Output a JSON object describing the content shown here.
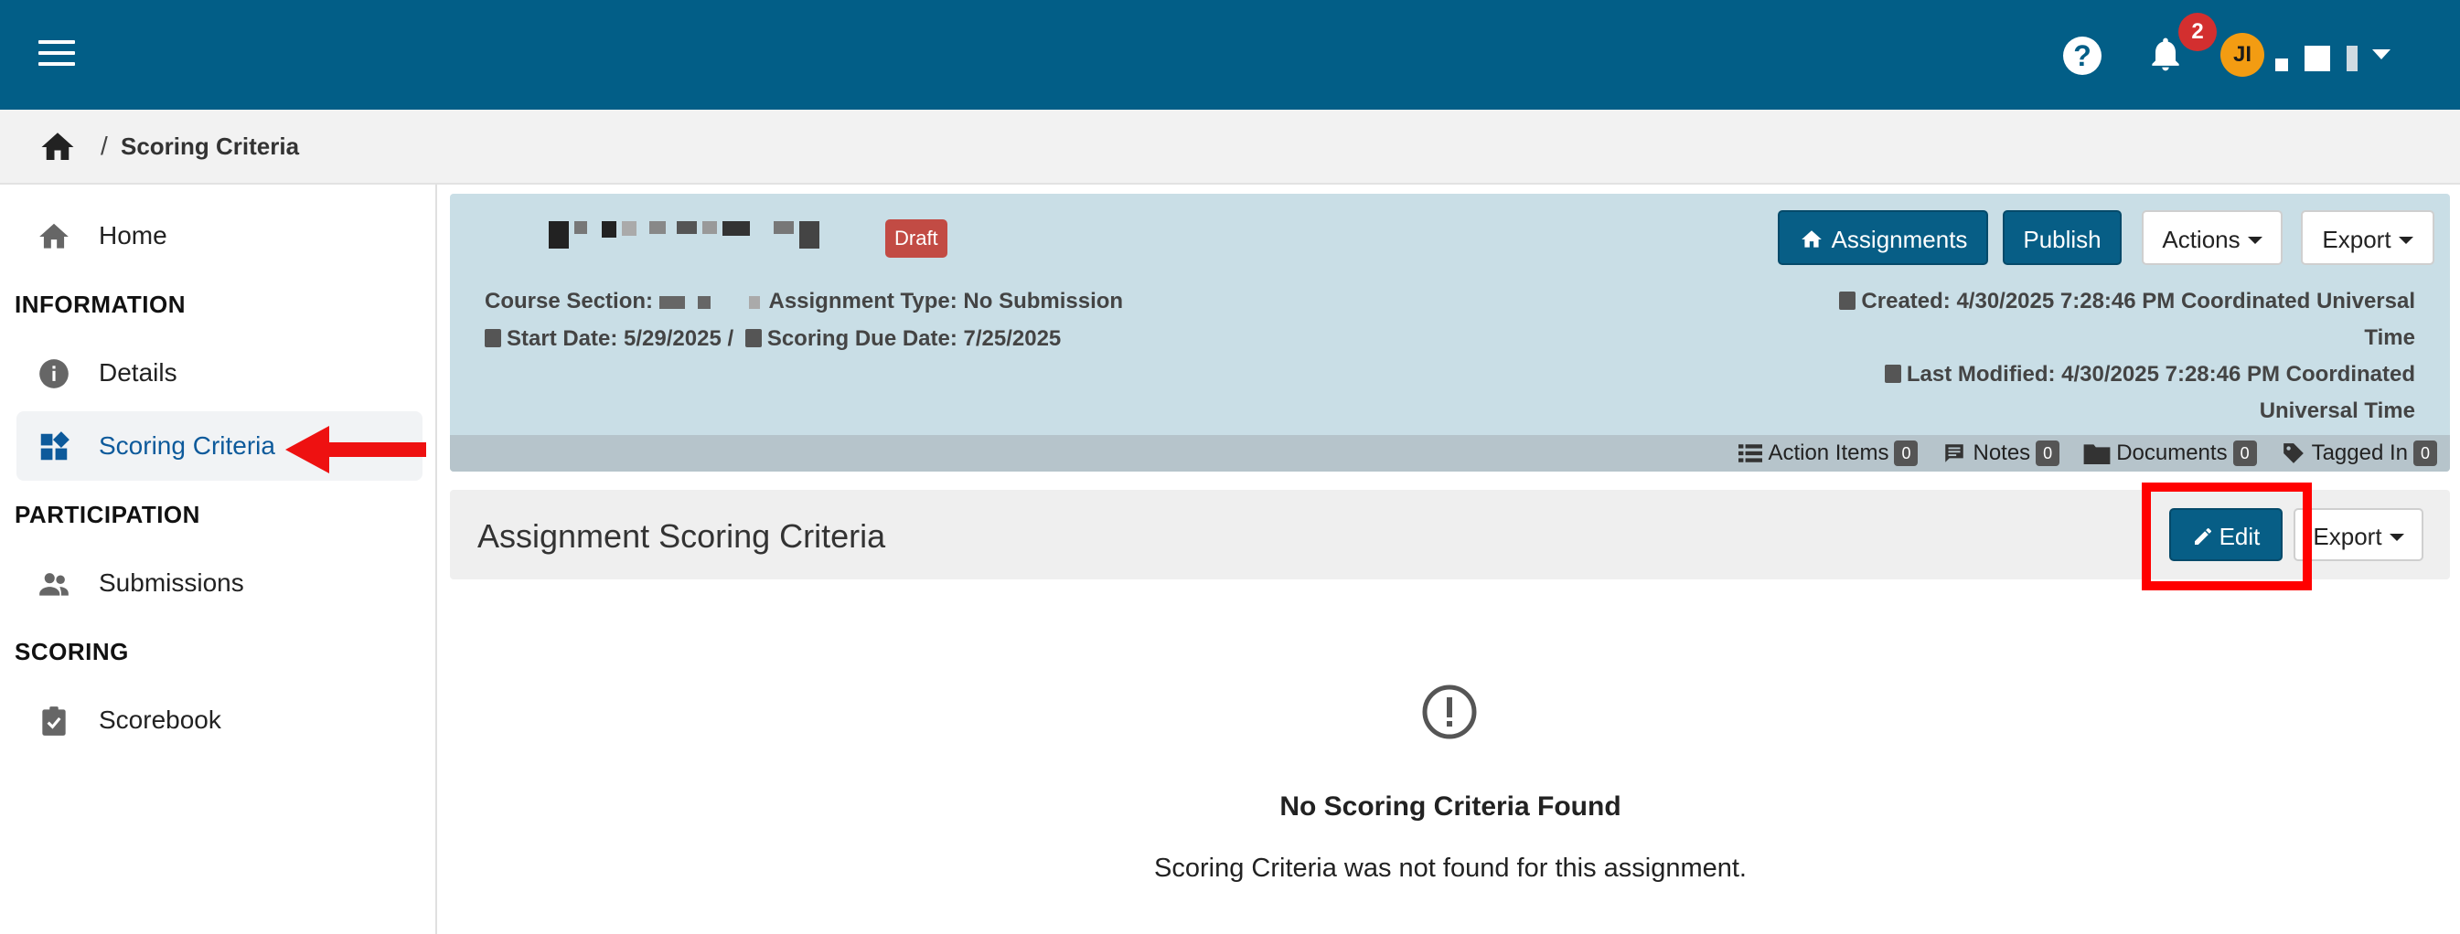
{
  "topbar": {
    "notification_count": "2",
    "avatar_initials": "JI"
  },
  "breadcrumb": {
    "separator": "/",
    "current": "Scoring Criteria"
  },
  "sidebar": {
    "home": "Home",
    "section_information": "INFORMATION",
    "details": "Details",
    "scoring_criteria": "Scoring Criteria",
    "section_participation": "PARTICIPATION",
    "submissions": "Submissions",
    "section_scoring": "SCORING",
    "scorebook": "Scorebook"
  },
  "assignment": {
    "status_badge": "Draft",
    "course_section_label": "Course Section:",
    "assignment_type": "Assignment Type: No Submission",
    "start_date": "Start Date: 5/29/2025 /",
    "scoring_due_date": "Scoring Due Date: 7/25/2025",
    "created_line1": "Created: 4/30/2025 7:28:46 PM Coordinated Universal",
    "created_line2": "Time",
    "modified_line1": "Last Modified: 4/30/2025 7:28:46 PM Coordinated",
    "modified_line2": "Universal Time",
    "buttons": {
      "assignments": "Assignments",
      "publish": "Publish",
      "actions": "Actions",
      "export": "Export"
    },
    "counts": {
      "action_items_label": "Action Items",
      "action_items": "0",
      "notes_label": "Notes",
      "notes": "0",
      "documents_label": "Documents",
      "documents": "0",
      "tagged_in_label": "Tagged In",
      "tagged_in": "0"
    }
  },
  "scoring": {
    "title": "Assignment Scoring Criteria",
    "edit_label": "Edit",
    "export_label": "Export",
    "empty_title": "No Scoring Criteria Found",
    "empty_text": "Scoring Criteria was not found for this assignment."
  },
  "colors": {
    "topbar": "#025e87",
    "primary_button": "#075e86",
    "info_panel": "#c9dee6",
    "draft_badge": "#c24b44",
    "highlight": "#ff0000",
    "active_nav_text": "#0d5a9b"
  },
  "icons": {
    "menu": "hamburger-icon",
    "help": "help-icon",
    "bell": "bell-icon",
    "home": "home-icon",
    "details": "info-icon",
    "scoring_criteria": "dashboard-icon",
    "submissions": "people-icon",
    "scorebook": "clipboard-check-icon",
    "calendar": "calendar-icon",
    "list": "list-icon",
    "notes": "notes-icon",
    "folder": "folder-icon",
    "tag": "tag-icon",
    "pencil": "pencil-icon",
    "empty": "exclamation-circle-icon"
  }
}
